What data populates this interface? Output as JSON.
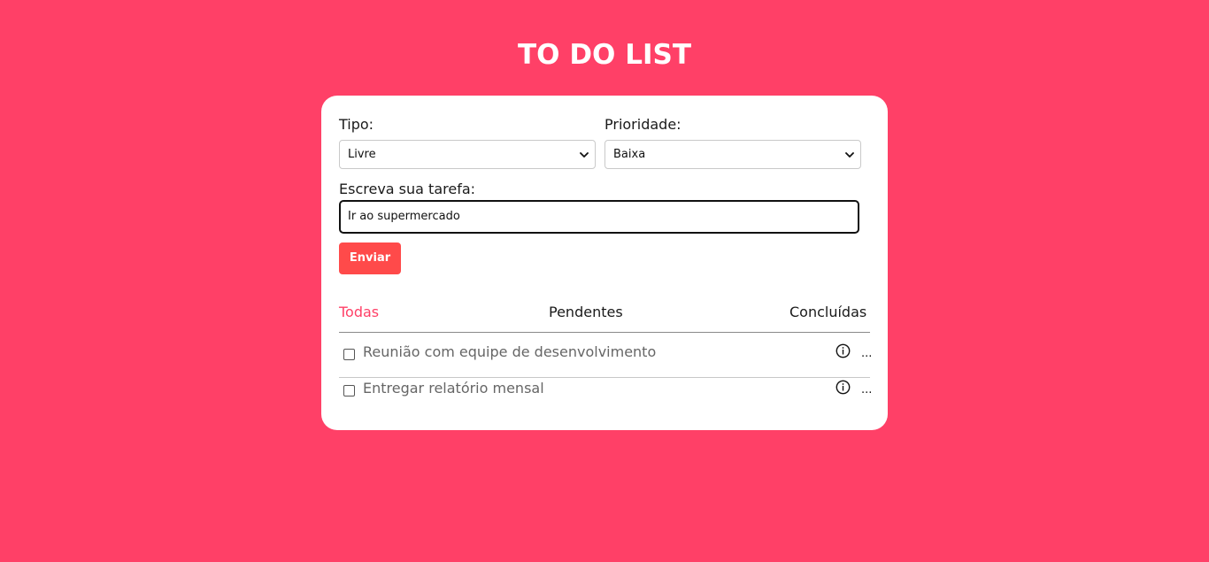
{
  "app": {
    "title": "TO DO LIST"
  },
  "form": {
    "tipo_label": "Tipo:",
    "tipo_value": "Livre",
    "prioridade_label": "Prioridade:",
    "prioridade_value": "Baixa",
    "task_label": "Escreva sua tarefa:",
    "task_value": "Ir ao supermercado",
    "send_label": "Enviar"
  },
  "tabs": [
    {
      "label": "Todas",
      "active": true
    },
    {
      "label": "Pendentes",
      "active": false
    },
    {
      "label": "Concluídas",
      "active": false
    }
  ],
  "tasks": [
    {
      "text": "Reunião com equipe de desenvolvimento",
      "done": false,
      "more": "..."
    },
    {
      "text": "Entregar relatório mensal",
      "done": false,
      "more": "..."
    }
  ],
  "colors": {
    "background": "#ff4067",
    "accent": "#ff4067",
    "button": "#ff4a4a"
  },
  "icons": {
    "select_arrow": "chevron-down-icon",
    "task_info": "info-icon",
    "task_more": "more-icon"
  }
}
